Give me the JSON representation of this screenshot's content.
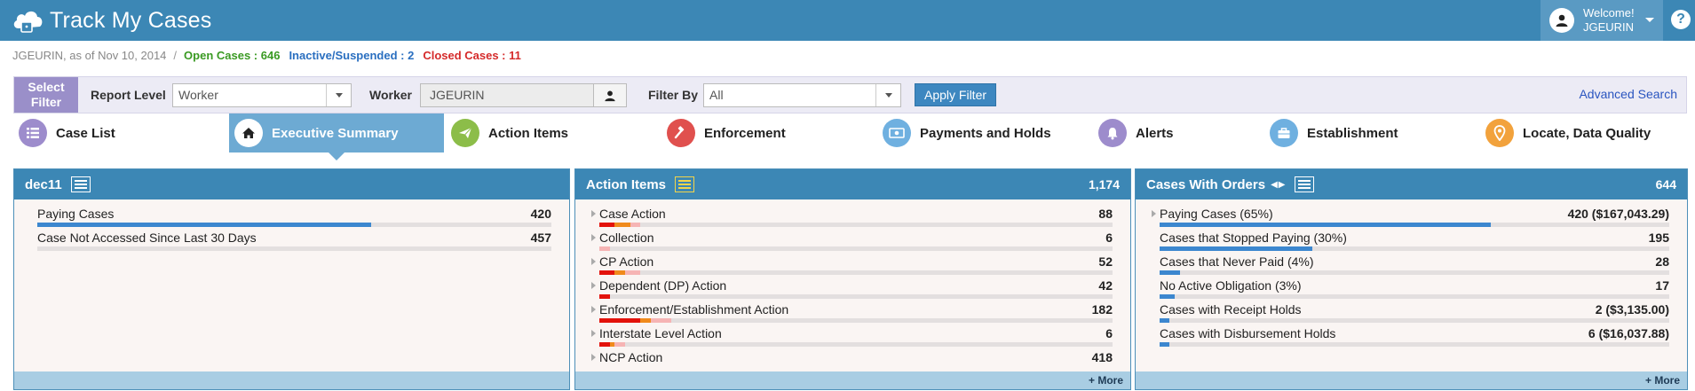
{
  "header": {
    "title": "Track My Cases",
    "logo_icon": "cloud-lock-icon",
    "welcome": "Welcome!",
    "username": "JGEURIN",
    "help": "?"
  },
  "breadcrumb": {
    "context": "JGEURIN, as of Nov 10, 2014",
    "separator": "/",
    "open_cases": "Open Cases : 646",
    "inactive_cases": "Inactive/Suspended : 2",
    "closed_cases": "Closed Cases : 11"
  },
  "filter": {
    "select_filter_label": "Select Filter",
    "report_level_label": "Report Level",
    "report_level_value": "Worker",
    "worker_label": "Worker",
    "worker_value": "JGEURIN",
    "filter_by_label": "Filter By",
    "filter_by_value": "All",
    "apply_label": "Apply Filter",
    "advanced_search_label": "Advanced Search"
  },
  "tabs": [
    {
      "label": "Case List",
      "icon": "list-icon",
      "color": "#9d8ccc"
    },
    {
      "label": "Executive Summary",
      "icon": "home-icon",
      "color": "#ffffff",
      "active": true
    },
    {
      "label": "Action Items",
      "icon": "paper-plane-icon",
      "color": "#8cbd49"
    },
    {
      "label": "Enforcement",
      "icon": "gavel-icon",
      "color": "#e0504e"
    },
    {
      "label": "Payments and Holds",
      "icon": "money-icon",
      "color": "#6fb0e0"
    },
    {
      "label": "Alerts",
      "icon": "bell-icon",
      "color": "#9d8ccc"
    },
    {
      "label": "Establishment",
      "icon": "briefcase-icon",
      "color": "#6fb0e0"
    },
    {
      "label": "Locate, Data Quality",
      "icon": "map-marker-icon",
      "color": "#f2a23c"
    }
  ],
  "panels": {
    "dec11": {
      "title": "dec11",
      "rows": [
        {
          "label": "Paying Cases",
          "value": "420",
          "fill": 0.65
        },
        {
          "label": "Case Not Accessed Since Last 30 Days",
          "value": "457",
          "fill": 0
        }
      ]
    },
    "action_items": {
      "title": "Action Items",
      "total": "1,174",
      "more": "+ More",
      "rows": [
        {
          "label": "Case Action",
          "value": "88",
          "segments": [
            0.03,
            0.03,
            0.02
          ]
        },
        {
          "label": "Collection",
          "value": "6",
          "segments": [
            0,
            0,
            0.02
          ]
        },
        {
          "label": "CP Action",
          "value": "52",
          "segments": [
            0.03,
            0.02,
            0.03
          ]
        },
        {
          "label": "Dependent (DP) Action",
          "value": "42",
          "segments": [
            0.02,
            0,
            0
          ]
        },
        {
          "label": "Enforcement/Establishment Action",
          "value": "182",
          "segments": [
            0.08,
            0.02,
            0.04
          ]
        },
        {
          "label": "Interstate Level Action",
          "value": "6",
          "segments": [
            0.02,
            0.01,
            0.02
          ]
        },
        {
          "label": "NCP Action",
          "value": "418",
          "segments": [
            0,
            0,
            0
          ]
        }
      ]
    },
    "cases_with_orders": {
      "title": "Cases With Orders",
      "total": "644",
      "more": "+ More",
      "rows": [
        {
          "label": "Paying Cases (65%)",
          "value": "420 ($167,043.29)",
          "fill": 0.65
        },
        {
          "label": "Cases that Stopped Paying (30%)",
          "value": "195",
          "fill": 0.3
        },
        {
          "label": "Cases that Never Paid (4%)",
          "value": "28",
          "fill": 0.04
        },
        {
          "label": "No Active Obligation (3%)",
          "value": "17",
          "fill": 0.03
        },
        {
          "label": "Cases with Receipt Holds",
          "value": "2 ($3,135.00)",
          "fill": 0.02
        },
        {
          "label": "Cases with Disbursement Holds",
          "value": "6 ($16,037.88)",
          "fill": 0.02
        }
      ]
    }
  },
  "colors": {
    "header_bg": "#3c87b5",
    "bar_blue": "#3c87cf",
    "seg_red": "#e3120b",
    "seg_orange": "#f08a1c",
    "seg_pink": "#f6b4b4"
  }
}
